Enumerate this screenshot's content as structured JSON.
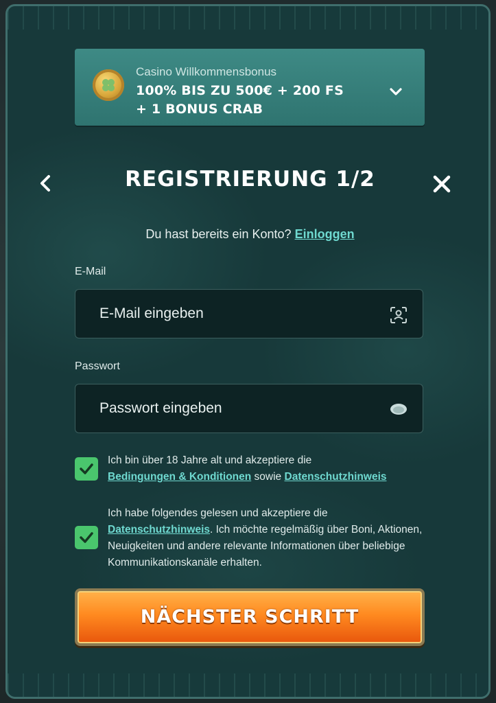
{
  "bonus_banner": {
    "title": "Casino Willkommensbonus",
    "line1": "100% BIS ZU 500€ + 200 FS",
    "line2": "+ 1 BONUS CRAB",
    "coin_icon": "clover-coin-icon",
    "expand_icon": "chevron-down-icon"
  },
  "header": {
    "title": "REGISTRIERUNG 1/2",
    "back_icon": "chevron-left-icon",
    "close_icon": "close-icon"
  },
  "login_prompt": {
    "text": "Du hast bereits ein Konto?",
    "link": "Einloggen"
  },
  "email": {
    "label": "E-Mail",
    "placeholder": "E-Mail eingeben",
    "value": "",
    "icon": "contact-scan-icon"
  },
  "password": {
    "label": "Passwort",
    "placeholder": "Passwort eingeben",
    "value": "",
    "icon": "eye-icon"
  },
  "consent_terms": {
    "checked": true,
    "text1": "Ich bin über 18 Jahre alt und akzeptiere die",
    "link1": "Bedingungen & Konditionen",
    "text2": "sowie",
    "link2": "Datenschutzhinweis"
  },
  "consent_marketing": {
    "checked": true,
    "text1": "Ich habe folgendes gelesen und akzeptiere die",
    "link1": "Datenschutzhinweis",
    "text2": ". Ich möchte regelmäßig über Boni, Aktionen, Neuigkeiten und andere relevante Informationen über beliebige Kommunikationskanäle erhalten."
  },
  "next_button": {
    "label": "NÄCHSTER SCHRITT"
  },
  "colors": {
    "accent_link": "#6fd9d0",
    "checkbox": "#4ac66d",
    "button_orange": "#ff8a20",
    "banner_teal": "#3e8a85",
    "panel_bg": "#17393a"
  }
}
